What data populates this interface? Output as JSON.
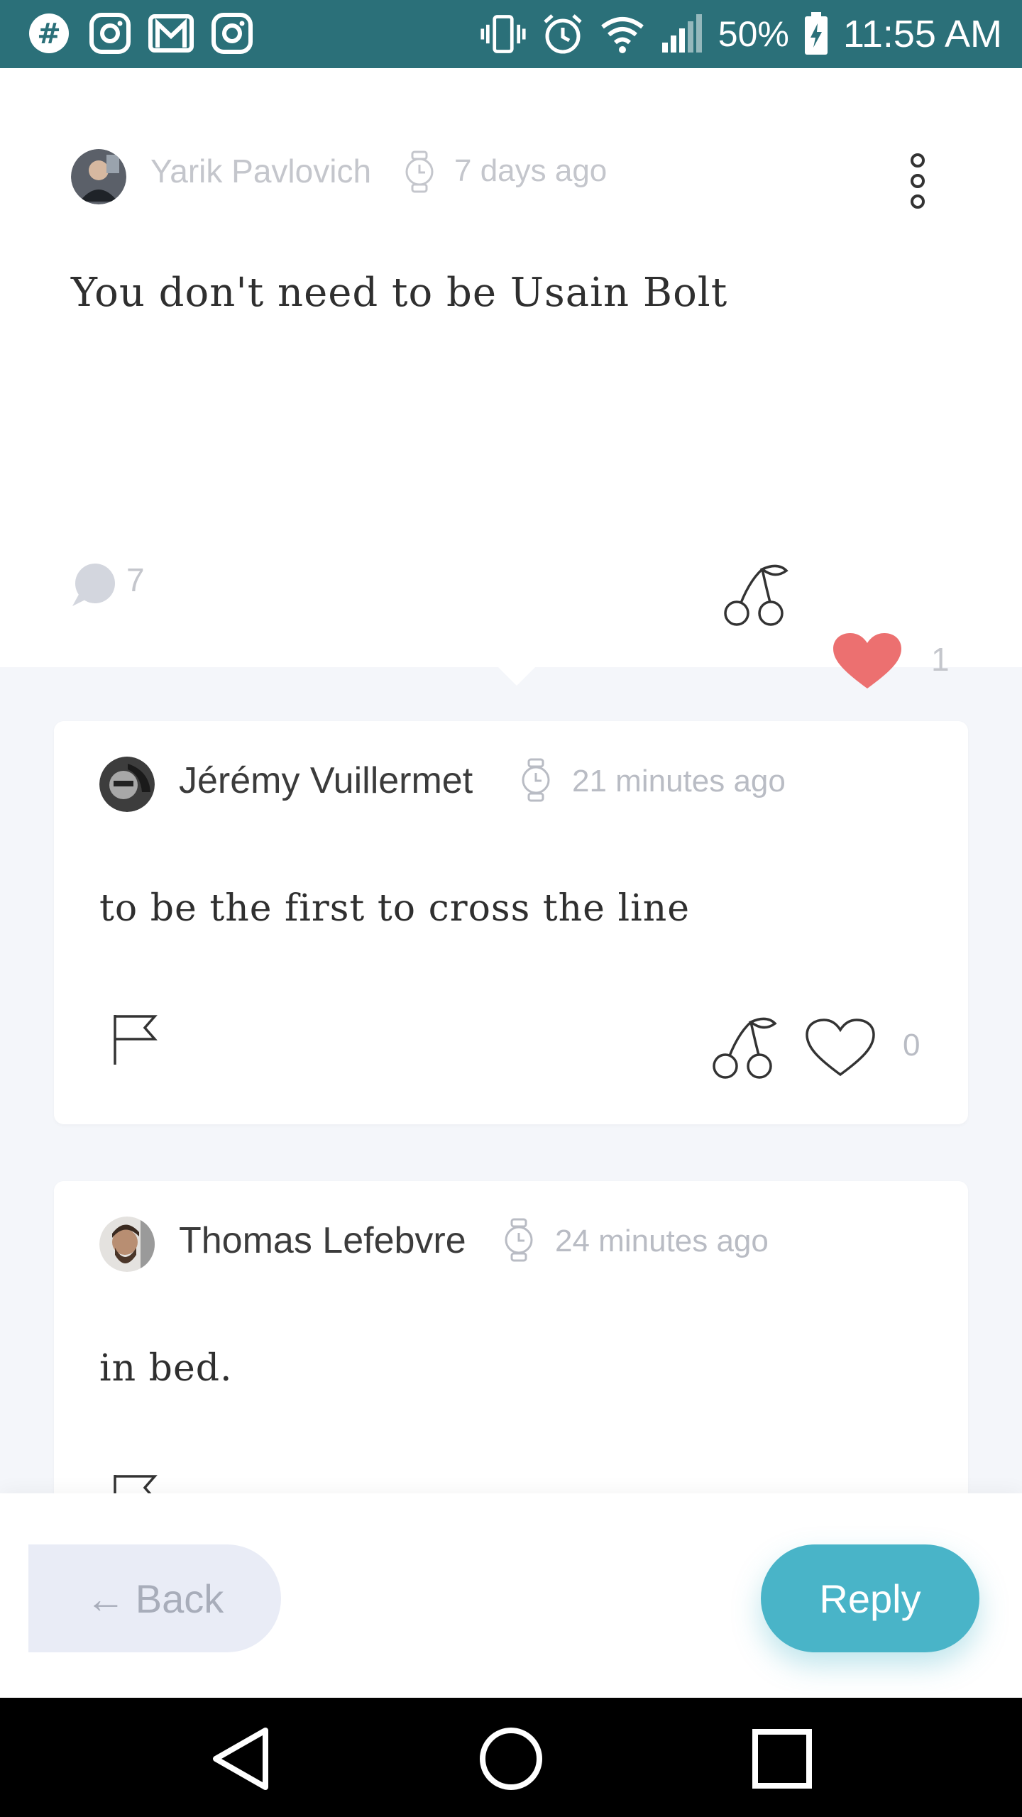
{
  "status_bar": {
    "time": "11:55 AM",
    "battery_percent": "50%",
    "left_icons": [
      "slack-icon",
      "instagram-icon",
      "gmail-icon",
      "instagram-icon"
    ],
    "right_icons": [
      "vibrate-icon",
      "alarm-icon",
      "wifi-icon",
      "signal-icon",
      "battery-charging-icon"
    ]
  },
  "post": {
    "author": "Yarik Pavlovich",
    "time": "7 days ago",
    "text": "You don't need to be Usain Bolt",
    "comment_count": "7",
    "like_count": "1",
    "liked": true,
    "heart_color": "#ec7070"
  },
  "comments": [
    {
      "author": "Jérémy Vuillermet",
      "time": "21 minutes ago",
      "text": "to be the first to cross the line",
      "like_count": "0"
    },
    {
      "author": "Thomas Lefebvre",
      "time": "24 minutes ago",
      "text": "in bed."
    }
  ],
  "actions": {
    "back_label": "Back",
    "reply_label": "Reply",
    "reply_color": "#49b4c8"
  }
}
